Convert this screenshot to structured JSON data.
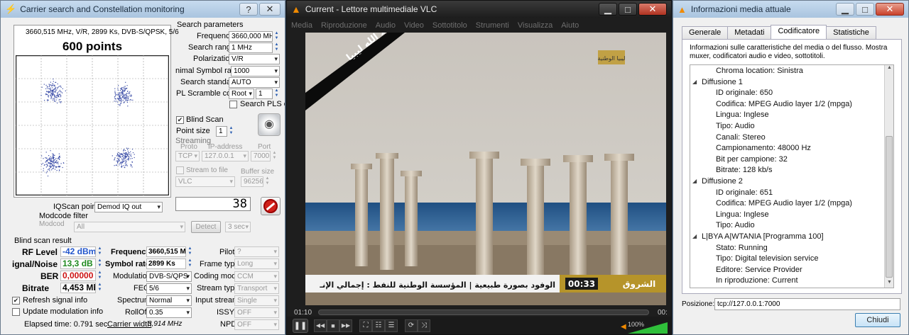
{
  "left": {
    "title": "Carrier search and Constellation monitoring",
    "help": "?",
    "close": "✕",
    "constellation": {
      "info": "3660,515 MHz, V/R, 2899 Ks, DVB-S/QPSK, 5/6",
      "points": "600 points"
    },
    "search_params": {
      "heading": "Search parameters",
      "frequency_label": "Frequency",
      "frequency": "3660,000 MHz",
      "range_label": "Search range",
      "range": "1 MHz",
      "polarization_label": "Polarization",
      "polarization": "V/R",
      "minsr_label": "nimal Symbol rate",
      "minsr": "1000",
      "standard_label": "Search standard",
      "standard": "AUTO",
      "plscramble_label": "PL Scramble code",
      "plscramble": "Root",
      "plscramble_num": "1",
      "plscc_label": "Search PLS cc",
      "blind_label": "Blind Scan",
      "blind_check": "✔",
      "pointsize_label": "Point size",
      "pointsize": "1",
      "streaming_label": "Streaming",
      "proto_label": "Proto",
      "ip_label": "IP-address",
      "port_label": "Port",
      "proto": "TCP",
      "ip": "127.0.0.1",
      "port": "7000",
      "streamfile_label": "Stream to file",
      "buffer_label": "Buffer size",
      "vlc": "VLC",
      "buffer": "96256"
    },
    "counter": "38",
    "iq_label": "IQScan point",
    "iq": "Demod IQ out",
    "modcode_filter_label": "Modcode filter",
    "modcode_label": "Modcod",
    "modcode": "All",
    "detect": "Detect",
    "sec": "3 sec",
    "results": {
      "heading": "Blind scan result",
      "rflevel_label": "RF Level",
      "rflevel": "-42 dBm",
      "snr_label": "ignal/Noise",
      "snr": "13,3 dB",
      "ber_label": "BER",
      "ber": "0,00000",
      "bitrate_label": "Bitrate",
      "bitrate": "4,453 Mb",
      "freq_label": "Frequency",
      "freq": "3660,515 M",
      "sr_label": "Symbol rate",
      "sr": "2899 Ks",
      "mod_label": "Modulation",
      "mod": "DVB-S/QPS",
      "fec_label": "FEC",
      "fec": "5/6",
      "spectrum_label": "Spectrum",
      "spectrum": "Normal",
      "rolloff_label": "RollOff",
      "rolloff": "0.35",
      "carrierwidth_label": "Carrier width",
      "carrierwidth": "3,914 MHz",
      "pilot_label": "Pilot",
      "pilot": "?",
      "frametype_label": "Frame type",
      "frametype": "Long",
      "codingmode_label": "Coding mode",
      "codingmode": "CCM",
      "streamtype_label": "Stream type",
      "streamtype": "Transport",
      "inputstream_label": "Input stream",
      "inputstream": "Single",
      "issyi_label": "ISSYI",
      "issyi": "OFF",
      "npd_label": "NPD",
      "npd": "OFF"
    },
    "refresh_label": "Refresh signal info",
    "refresh_check": "✔",
    "update_label": "Update modulation info",
    "elapsed": "Elapsed time: 0.791 sec"
  },
  "vlc": {
    "title": "Current - Lettore multimediale VLC",
    "menu": [
      "Media",
      "Riproduzione",
      "Audio",
      "Video",
      "Sottotitolo",
      "Strumenti",
      "Visualizza",
      "Aiuto"
    ],
    "ticker_time": "00:33",
    "ticker_text": "الوفود بصورة طبيعية   |   المؤسسة الوطنية للنفط : إجمالي الإنـ",
    "ticker_brand": "الشروق",
    "banner_text": "حفظ الله ليبيا",
    "logo_text": "ليبيا الوطنية",
    "time_elapsed": "01:10",
    "time_total": "00:",
    "volume": "100%"
  },
  "info": {
    "title": "Informazioni media attuale",
    "tabs": [
      "Generale",
      "Metadati",
      "Codificatore",
      "Statistiche"
    ],
    "description": "Informazioni sulle caratteristiche del media o del flusso. Mostra muxer, codificatori audio e video, sottotitoli.",
    "tree": [
      {
        "indent": 2,
        "text": "Chroma location: Sinistra"
      },
      {
        "indent": 1,
        "text": "Diffusione 1",
        "toggle": "◢"
      },
      {
        "indent": 2,
        "text": "ID originale: 650"
      },
      {
        "indent": 2,
        "text": "Codifica: MPEG Audio layer 1/2 (mpga)"
      },
      {
        "indent": 2,
        "text": "Lingua: Inglese"
      },
      {
        "indent": 2,
        "text": "Tipo: Audio"
      },
      {
        "indent": 2,
        "text": "Canali: Stereo"
      },
      {
        "indent": 2,
        "text": "Campionamento: 48000 Hz"
      },
      {
        "indent": 2,
        "text": "Bit per campione: 32"
      },
      {
        "indent": 2,
        "text": "Bitrate: 128 kb/s"
      },
      {
        "indent": 1,
        "text": "Diffusione 2",
        "toggle": "◢"
      },
      {
        "indent": 2,
        "text": "ID originale: 651"
      },
      {
        "indent": 2,
        "text": "Codifica: MPEG Audio layer 1/2 (mpga)"
      },
      {
        "indent": 2,
        "text": "Lingua: Inglese"
      },
      {
        "indent": 2,
        "text": "Tipo: Audio"
      },
      {
        "indent": 1,
        "text": "L|BYA A|WTANIA [Programma 100]",
        "toggle": "◢"
      },
      {
        "indent": 2,
        "text": "Stato: Running"
      },
      {
        "indent": 2,
        "text": "Tipo: Digital television service"
      },
      {
        "indent": 2,
        "text": "Editore: Service Provider"
      },
      {
        "indent": 2,
        "text": "In riproduzione: Current"
      }
    ],
    "position_label": "Posizione:",
    "position": "tcp://127.0.0.1:7000",
    "close_button": "Chiudi"
  }
}
